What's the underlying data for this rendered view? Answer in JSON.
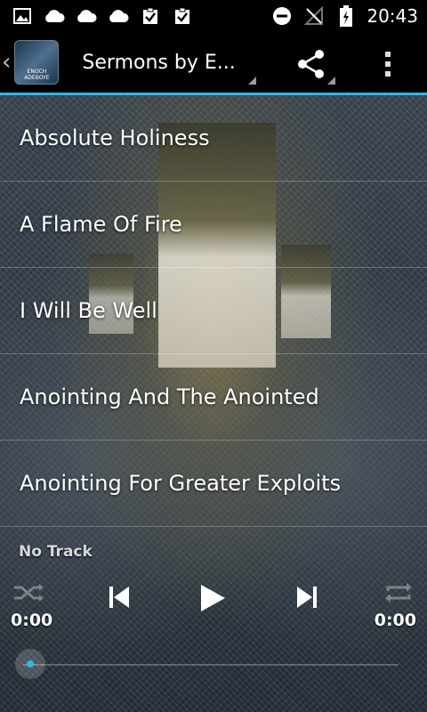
{
  "status_bar": {
    "left_icons": [
      "image-icon",
      "cloud-icon",
      "cloud-icon",
      "cloud-icon",
      "clipboard-check-icon",
      "clipboard-check-icon"
    ],
    "right_icons": [
      "do-not-disturb-icon",
      "no-signal-icon",
      "battery-charging-icon"
    ],
    "time": "20:43"
  },
  "action_bar": {
    "logo_text": "ENOCH ADEBOYE",
    "title": "Sermons by E...",
    "accent_color": "#33b5e5"
  },
  "sermons": [
    {
      "title": "Absolute Holiness"
    },
    {
      "title": "A Flame Of Fire"
    },
    {
      "title": "I Will Be Well"
    },
    {
      "title": "Anointing And The Anointed"
    },
    {
      "title": "Anointing For Greater Exploits"
    }
  ],
  "player": {
    "track": "No Track",
    "elapsed": "0:00",
    "duration": "0:00",
    "progress": 0
  }
}
